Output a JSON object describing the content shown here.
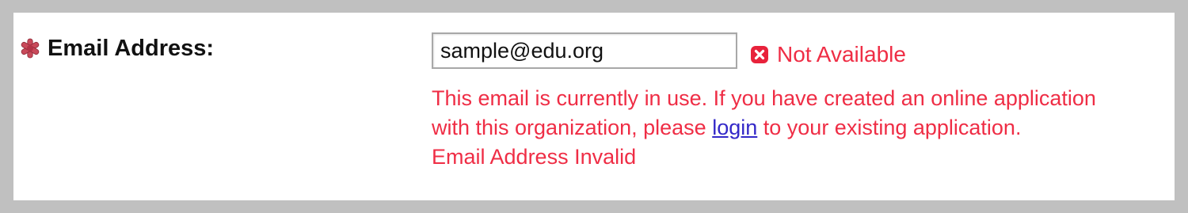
{
  "field": {
    "label": "Email Address:",
    "required_icon": "asterisk-icon",
    "value": "sample@edu.org"
  },
  "status": {
    "icon": "error-x-icon",
    "text": "Not Available"
  },
  "messages": {
    "line1": "This email is currently in use. If you have created an online application",
    "line2_before": "with this organization, please ",
    "login_link": "login",
    "line2_after": " to your existing application.",
    "line3": "Email Address Invalid"
  },
  "colors": {
    "error": "#ef2d45",
    "link": "#3328c8",
    "frame": "#c0c0c0"
  }
}
